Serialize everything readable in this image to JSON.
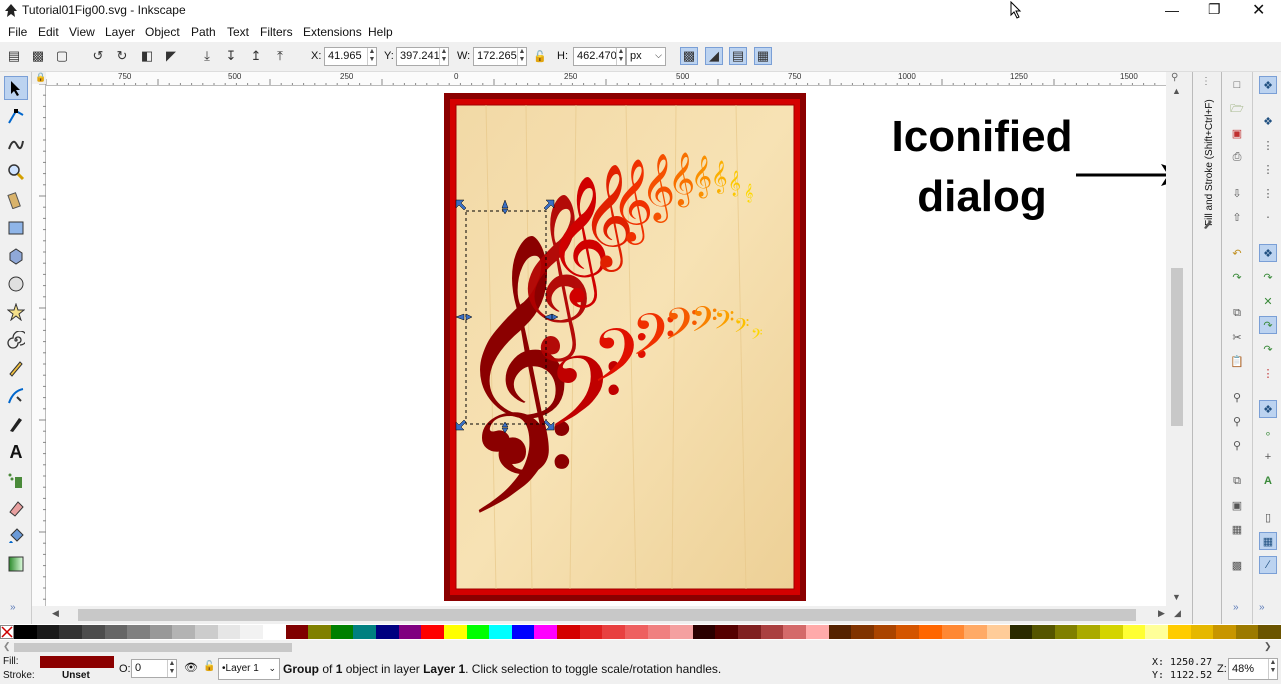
{
  "window": {
    "title": "Tutorial01Fig00.svg - Inkscape",
    "controls": [
      "minimize",
      "maximize",
      "close"
    ]
  },
  "menu": [
    "File",
    "Edit",
    "View",
    "Layer",
    "Object",
    "Path",
    "Text",
    "Filters",
    "Extensions",
    "Help"
  ],
  "toolbar": {
    "x_label": "X:",
    "x_value": "41.965",
    "y_label": "Y:",
    "y_value": "397.241",
    "w_label": "W:",
    "w_value": "172.265",
    "h_label": "H:",
    "h_value": "462.470",
    "unit": "px"
  },
  "ruler_h_labels": [
    "750",
    "500",
    "250",
    "0",
    "250",
    "500",
    "750",
    "1000",
    "1250",
    "1500"
  ],
  "dock": {
    "iconified_dialog_label": "Fill and Stroke (Shift+Ctrl+F)"
  },
  "annotation": {
    "line1": "Iconified",
    "line2": "dialog"
  },
  "status": {
    "fill_label": "Fill:",
    "stroke_label": "Stroke:",
    "fill_color": "#8b0000",
    "stroke_value": "Unset",
    "opacity_label": "O:",
    "opacity_value": "0",
    "layer_value": "•Layer 1",
    "message_bold": "Group",
    "message_mid": " of ",
    "message_count": "1",
    "message_text": " object in layer ",
    "message_layer": "Layer 1",
    "message_tail": ". Click selection to toggle scale/rotation handles.",
    "x_coord": "X: 1250.27",
    "y_coord": "Y: 1122.52",
    "zoom_label": "Z:",
    "zoom_value": "48%"
  },
  "palette_colors": [
    "#000000",
    "#1a1a1a",
    "#333333",
    "#4d4d4d",
    "#666666",
    "#808080",
    "#999999",
    "#b3b3b3",
    "#cccccc",
    "#e6e6e6",
    "#f2f2f2",
    "#ffffff",
    "#800000",
    "#808000",
    "#008000",
    "#008080",
    "#000080",
    "#800080",
    "#ff0000",
    "#ffff00",
    "#00ff00",
    "#00ffff",
    "#0000ff",
    "#ff00ff",
    "#d40000",
    "#e02020",
    "#e84040",
    "#ee6060",
    "#f08080",
    "#f4a0a0",
    "#2b0000",
    "#550000",
    "#802020",
    "#aa4040",
    "#d46a6a",
    "#ffaaaa",
    "#552200",
    "#803300",
    "#aa4400",
    "#d45500",
    "#ff6600",
    "#ff8833",
    "#ffaa66",
    "#ffcc99",
    "#2b2b00",
    "#555500",
    "#808000",
    "#aaaa00",
    "#d4d400",
    "#ffff33",
    "#ffff99",
    "#ffcc00",
    "#e6b800",
    "#c89600",
    "#9c7a00",
    "#6b5400"
  ],
  "colors": {
    "frame_red": "#b30000",
    "wood": "#f2d9a6",
    "accent_blue": "#3a6fc4"
  }
}
